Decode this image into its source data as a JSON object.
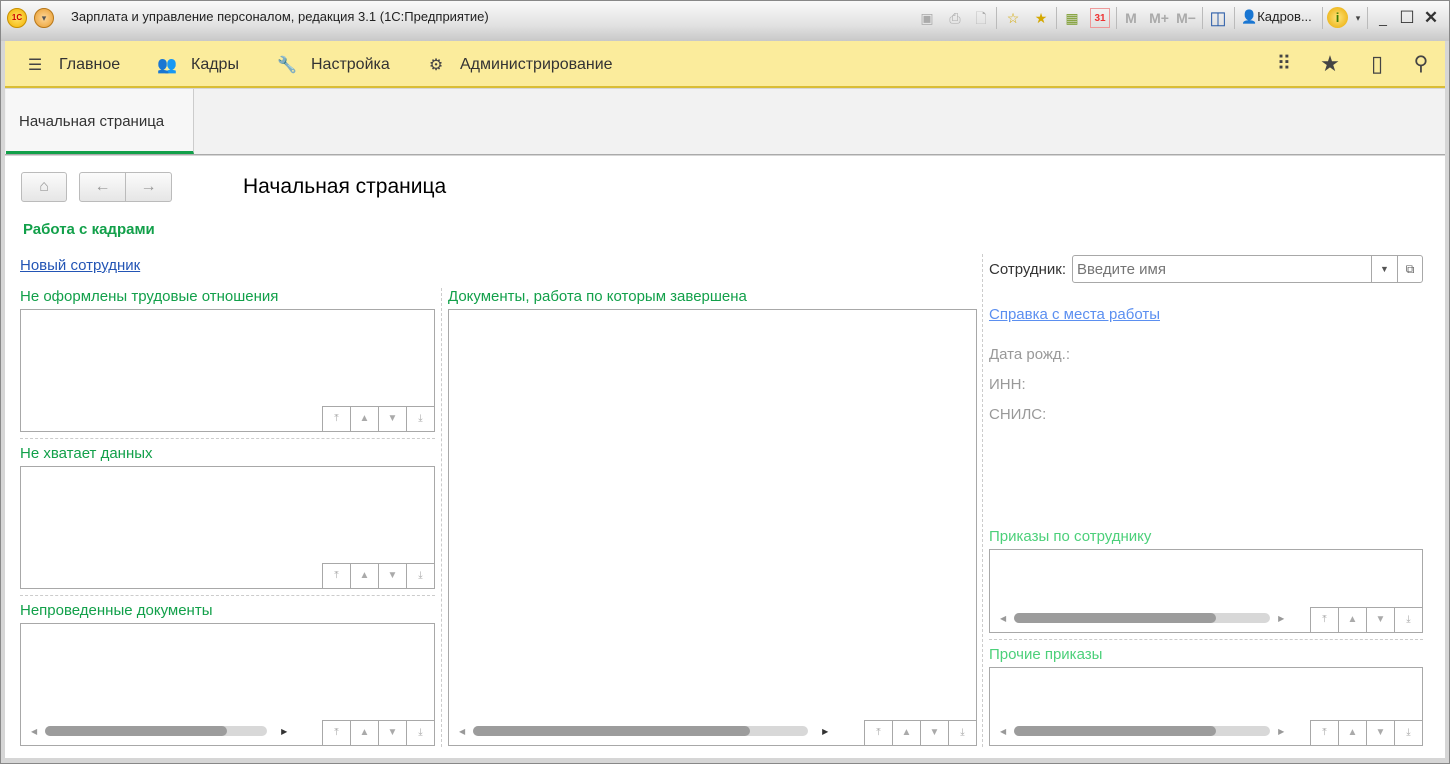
{
  "window": {
    "title": "Зарплата и управление персоналом, редакция 3.1  (1С:Предприятие)",
    "logo": "1С",
    "user": "Кадров...",
    "toolbar": {
      "m": "M",
      "mplus": "M+",
      "mminus": "M−",
      "calendar": "31"
    }
  },
  "menu": {
    "items": [
      {
        "label": "Главное",
        "icon": "hamburger-icon"
      },
      {
        "label": "Кадры",
        "icon": "users-icon"
      },
      {
        "label": "Настройка",
        "icon": "wrench-icon"
      },
      {
        "label": "Администрирование",
        "icon": "gear-icon"
      }
    ]
  },
  "tabs": [
    {
      "label": "Начальная страница",
      "active": true
    }
  ],
  "page": {
    "title": "Начальная страница",
    "section": "Работа с кадрами",
    "new_employee_link": "Новый сотрудник",
    "panels": {
      "not_formalized": "Не оформлены трудовые отношения",
      "missing_data": "Не хватает данных",
      "unposted": "Непроведенные документы",
      "completed": "Документы, работа по которым завершена",
      "employee_orders": "Приказы по сотруднику",
      "other_orders": "Прочие приказы"
    },
    "employee": {
      "label": "Сотрудник:",
      "placeholder": "Введите имя",
      "value": "",
      "certificate_link": "Справка с места работы",
      "birth_date_label": "Дата рожд.:",
      "inn_label": "ИНН:",
      "snils_label": "СНИЛС:"
    }
  },
  "colors": {
    "accent": "#12a04a",
    "menubar": "#fbec9c",
    "link": "#2355b5",
    "link_light": "#5b8ff0",
    "light_green": "#4cd07a"
  }
}
